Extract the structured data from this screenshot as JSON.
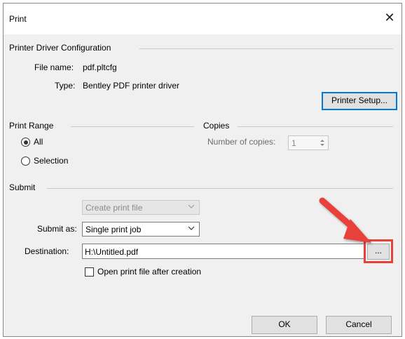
{
  "window": {
    "title": "Print",
    "close_glyph": "✕"
  },
  "driver": {
    "section_label": "Printer Driver Configuration",
    "file_name_label": "File name:",
    "file_name_value": "pdf.pltcfg",
    "type_label": "Type:",
    "type_value": "Bentley PDF printer driver",
    "setup_button": "Printer Setup..."
  },
  "print_range": {
    "section_label": "Print Range",
    "options": [
      {
        "label": "All",
        "selected": true
      },
      {
        "label": "Selection",
        "selected": false
      }
    ]
  },
  "copies": {
    "section_label": "Copies",
    "number_label": "Number of copies:",
    "number_value": "1"
  },
  "submit": {
    "section_label": "Submit",
    "create_combo_value": "Create print file",
    "submit_as_label": "Submit as:",
    "submit_as_value": "Single print job",
    "destination_label": "Destination:",
    "destination_value": "H:\\Untitled.pdf",
    "browse_button": "...",
    "open_after_label": "Open print file after creation",
    "open_after_checked": false
  },
  "footer": {
    "ok": "OK",
    "cancel": "Cancel"
  },
  "annotation": {
    "arrow_color": "#e8413a",
    "highlight_color": "#e8413a"
  }
}
